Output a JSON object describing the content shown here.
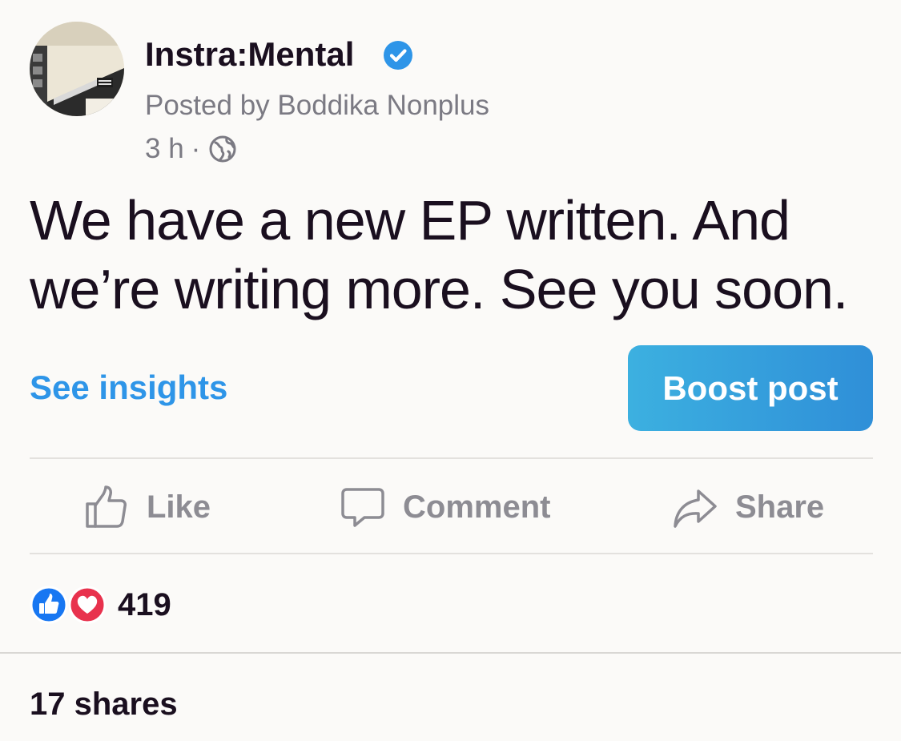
{
  "post": {
    "page_name": "Instra:Mental",
    "verified_icon": "verified-badge-icon",
    "posted_by": "Posted by Boddika Nonplus",
    "time": "3 h",
    "separator": "·",
    "audience_icon": "globe-icon",
    "text_line1": "We have a new EP written. And",
    "text_line2": "we’re writing more. See you soon."
  },
  "actions": {
    "see_insights": "See insights",
    "boost_post": "Boost post",
    "like": "Like",
    "comment": "Comment",
    "share": "Share"
  },
  "stats": {
    "reaction_icons": [
      "like-reaction-icon",
      "love-reaction-icon"
    ],
    "reaction_count": "419",
    "shares": "17 shares"
  },
  "colors": {
    "link_blue": "#2e95e8",
    "boost_gradient_start": "#3cb0e0",
    "boost_gradient_end": "#2f8fd8",
    "verified_blue": "#2e95e8",
    "muted_text": "#7b7a83",
    "like_blue": "#1877f2",
    "love_red": "#e8324d"
  }
}
